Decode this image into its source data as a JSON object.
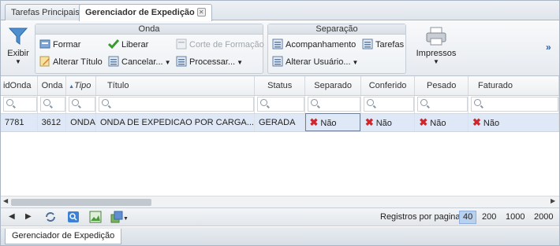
{
  "tabs": [
    {
      "label": "Tarefas Principais"
    },
    {
      "label": "Gerenciador de Expedição",
      "close": "✕"
    }
  ],
  "ribbon": {
    "exibir_label": "Exibir",
    "onda": {
      "title": "Onda",
      "formar": "Formar",
      "alterar_titulo": "Alterar Título",
      "liberar": "Liberar",
      "cancelar": "Cancelar...",
      "corte": "Corte de Formação",
      "processar": "Processar..."
    },
    "separacao": {
      "title": "Separação",
      "acompanhamento": "Acompanhamento",
      "tarefas": "Tarefas",
      "alterar_usuario": "Alterar Usuário..."
    },
    "impressos_label": "Impressos",
    "more": "»"
  },
  "grid": {
    "columns": [
      "idOnda",
      "Onda",
      "Tipo",
      "Título",
      "Status",
      "Separado",
      "Conferido",
      "Pesado",
      "Faturado"
    ],
    "rows": [
      {
        "idOnda": "7781",
        "onda": "3612",
        "tipo": "ONDA",
        "titulo": "ONDA DE EXPEDICAO POR CARGA...",
        "status": "GERADA",
        "separado": "Não",
        "conferido": "Não",
        "pesado": "Não",
        "faturado": "Não"
      }
    ]
  },
  "pager": {
    "label": "Registros por pagina:",
    "sizes": [
      "40",
      "200",
      "1000",
      "2000"
    ]
  },
  "bottom_tab": "Gerenciador de Expedição"
}
